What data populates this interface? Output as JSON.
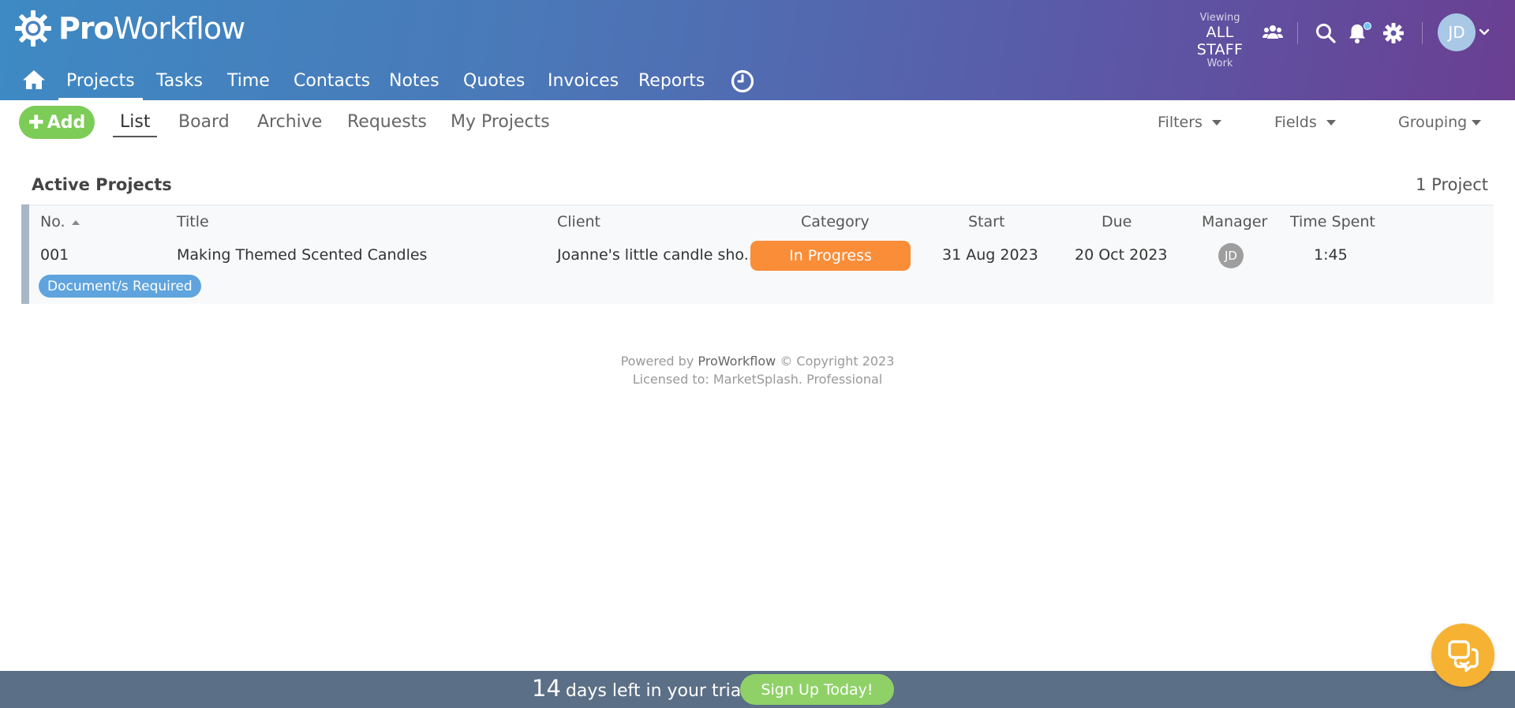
{
  "brand": {
    "logo_bold": "Pro",
    "logo_rest": "Workflow"
  },
  "header": {
    "viewing_label": "Viewing",
    "viewing_value": "ALL STAFF",
    "viewing_sub": "Work",
    "user_initials": "JD"
  },
  "nav": {
    "items": [
      "Projects",
      "Tasks",
      "Time",
      "Contacts",
      "Notes",
      "Quotes",
      "Invoices",
      "Reports"
    ],
    "active": "Projects"
  },
  "subnav": {
    "add_label": "Add",
    "tabs": [
      "List",
      "Board",
      "Archive",
      "Requests",
      "My Projects"
    ],
    "active": "List",
    "tools": [
      "Filters",
      "Fields",
      "Grouping"
    ]
  },
  "section": {
    "title": "Active Projects",
    "count": "1 Project",
    "columns": [
      "No.",
      "Title",
      "Client",
      "Category",
      "Start",
      "Due",
      "Manager",
      "Time Spent"
    ],
    "rows": [
      {
        "no": "001",
        "title": "Making Themed Scented Candles",
        "client": "Joanne's little candle sho...",
        "category": "In Progress",
        "start": "31 Aug 2023",
        "due": "20 Oct 2023",
        "manager": "JD",
        "time_spent": "1:45",
        "tag": "Document/s Required"
      }
    ]
  },
  "footer": {
    "powered_by": "Powered by",
    "brand": "ProWorkflow",
    "copyright": "© Copyright 2023",
    "licensed": "Licensed to: MarketSplash. Professional"
  },
  "trial": {
    "days": "14",
    "text": "days left in your trial",
    "button": "Sign Up Today!"
  },
  "colors": {
    "category_badge": "#f98d38",
    "tag": "#5fa4de",
    "add_button": "#7dcc57",
    "trial_bar": "#5b6f86",
    "signup_button": "#8fd167",
    "chat_button": "#f5b233"
  }
}
